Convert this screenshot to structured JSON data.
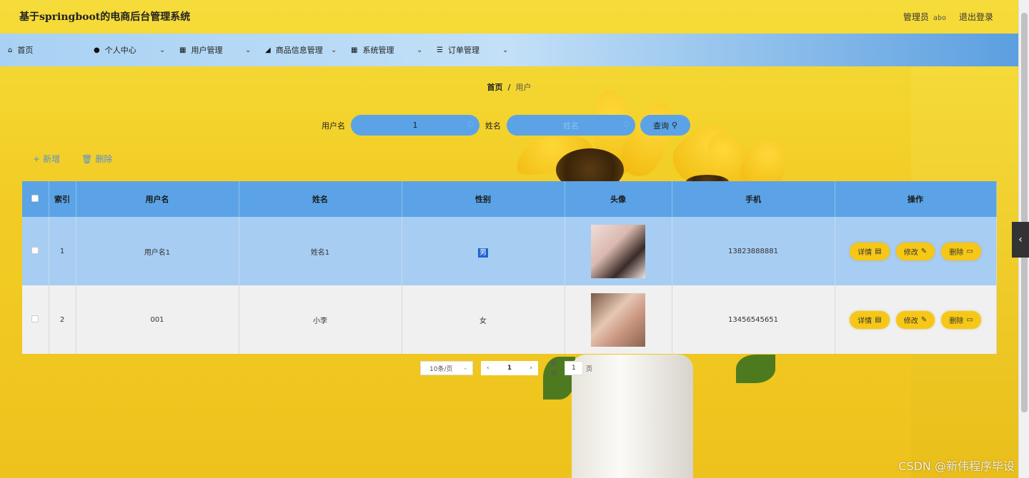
{
  "header": {
    "title": "基于springboot的电商后台管理系统",
    "user_label": "管理员",
    "user_name": "abo",
    "logout": "退出登录"
  },
  "nav": {
    "items": [
      {
        "label": "首页",
        "icon": "home-icon"
      },
      {
        "label": "个人中心",
        "icon": "user-icon"
      },
      {
        "label": "用户管理",
        "icon": "grid-icon"
      },
      {
        "label": "商品信息管理",
        "icon": "chart-icon"
      },
      {
        "label": "系统管理",
        "icon": "grid-icon"
      },
      {
        "label": "订单管理",
        "icon": "list-icon"
      }
    ]
  },
  "breadcrumb": {
    "home": "首页",
    "sep": "/",
    "current": "用户"
  },
  "search": {
    "username_label": "用户名",
    "username_value": "1",
    "name_label": "姓名",
    "name_placeholder": "姓名",
    "button": "查询"
  },
  "actions": {
    "add": "新增",
    "delete": "删除"
  },
  "table": {
    "headers": [
      "索引",
      "用户名",
      "姓名",
      "性别",
      "头像",
      "手机",
      "操作"
    ],
    "rows": [
      {
        "index": "1",
        "username": "用户名1",
        "name": "姓名1",
        "gender": "男",
        "phone": "13823888881"
      },
      {
        "index": "2",
        "username": "001",
        "name": "小李",
        "gender": "女",
        "phone": "13456545651"
      }
    ],
    "ops": {
      "detail": "详情",
      "edit": "修改",
      "delete": "删除"
    }
  },
  "pager": {
    "page_size": "10条/页",
    "current_page": "1",
    "goto_label": "前往",
    "goto_value": "1",
    "page_suffix": "页"
  },
  "watermark": "CSDN @新伟程序毕设",
  "colors": {
    "accent": "#5ba3e6",
    "op_button": "#f6c716",
    "background": "#f3cf2a"
  }
}
